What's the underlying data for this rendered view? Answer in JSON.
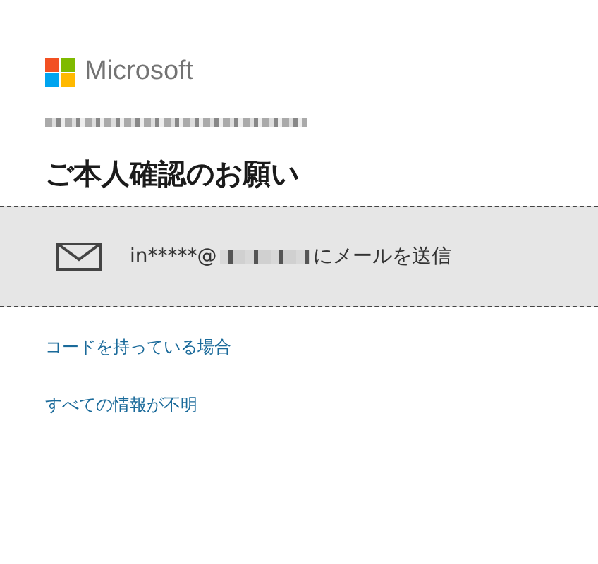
{
  "brand": {
    "name": "Microsoft"
  },
  "title": "ご本人確認のお願い",
  "options": [
    {
      "kind": "email",
      "prefix": "in*****@",
      "suffix": "にメールを送信",
      "selected": true
    }
  ],
  "links": [
    "コードを持っている場合",
    "すべての情報が不明"
  ]
}
